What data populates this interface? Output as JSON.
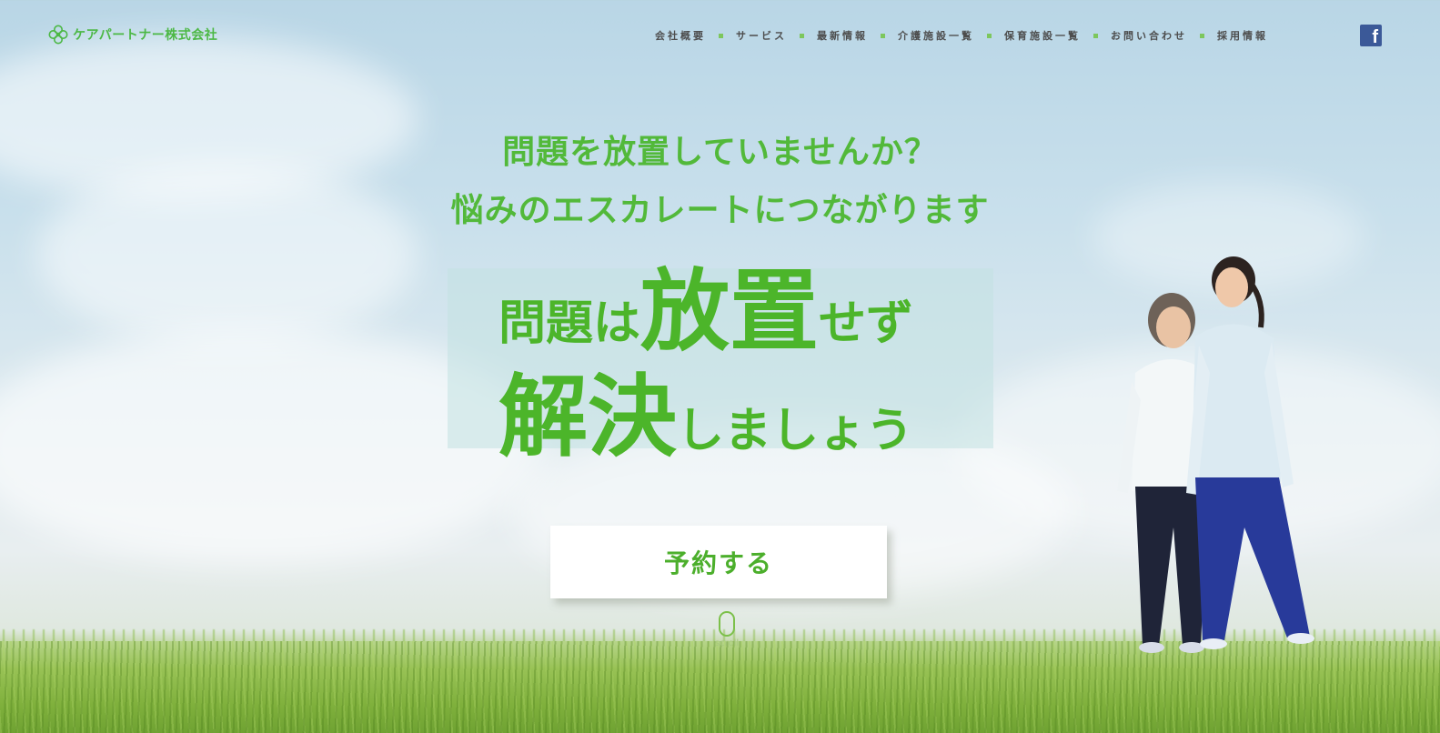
{
  "header": {
    "logo_text": "ケアパートナー株式会社",
    "nav": [
      {
        "label": "会社概要"
      },
      {
        "label": "サービス"
      },
      {
        "label": "最新情報"
      },
      {
        "label": "介護施設一覧"
      },
      {
        "label": "保育施設一覧"
      },
      {
        "label": "お問い合わせ"
      },
      {
        "label": "採用情報"
      }
    ],
    "facebook_icon": "facebook-icon",
    "facebook_glyph": "f"
  },
  "hero": {
    "question1": "問題を放置していませんか？",
    "question2": "悩みのエスカレートにつながります",
    "headline1_a": "問題は",
    "headline1_b": "放置",
    "headline1_c": "せず",
    "headline2_a": "解決",
    "headline2_b": "しましょう",
    "cta_label": "予約する",
    "scroll_label": "scroll"
  },
  "colors": {
    "accent": "#4cb52a",
    "nav_text": "#4d4d4d",
    "facebook": "#3b5998"
  }
}
